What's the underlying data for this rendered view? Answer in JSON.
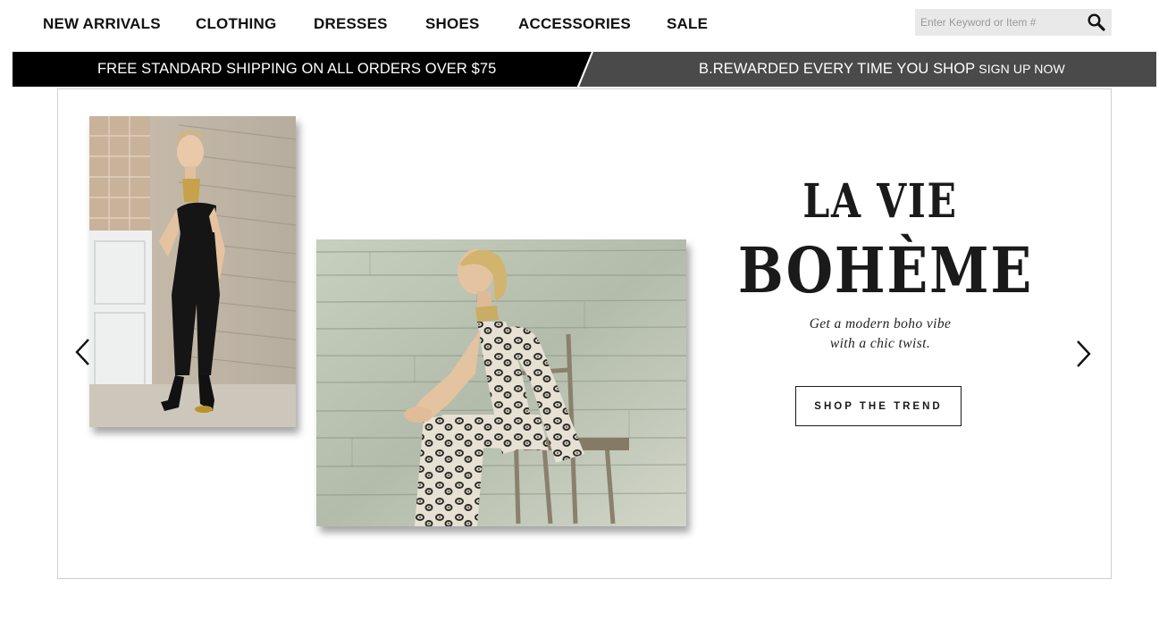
{
  "nav": {
    "items": [
      "NEW ARRIVALS",
      "CLOTHING",
      "DRESSES",
      "SHOES",
      "ACCESSORIES",
      "SALE"
    ]
  },
  "search": {
    "placeholder": "Enter Keyword or Item #",
    "icon": "search-icon"
  },
  "promo": {
    "left_text": "FREE STANDARD SHIPPING ON ALL ORDERS OVER $75",
    "right_text": "B.REWARDED EVERY TIME YOU SHOP",
    "right_link": "SIGN UP NOW",
    "colors": {
      "left_bg": "#000000",
      "right_bg": "#4a4a4a"
    }
  },
  "hero": {
    "headline_line1": "LA VIE",
    "headline_line2": "BOHÈME",
    "tagline_line1": "Get a modern boho vibe",
    "tagline_line2": "with a chic twist.",
    "cta_label": "SHOP THE TREND",
    "prev_icon": "chevron-left-icon",
    "next_icon": "chevron-right-icon"
  }
}
